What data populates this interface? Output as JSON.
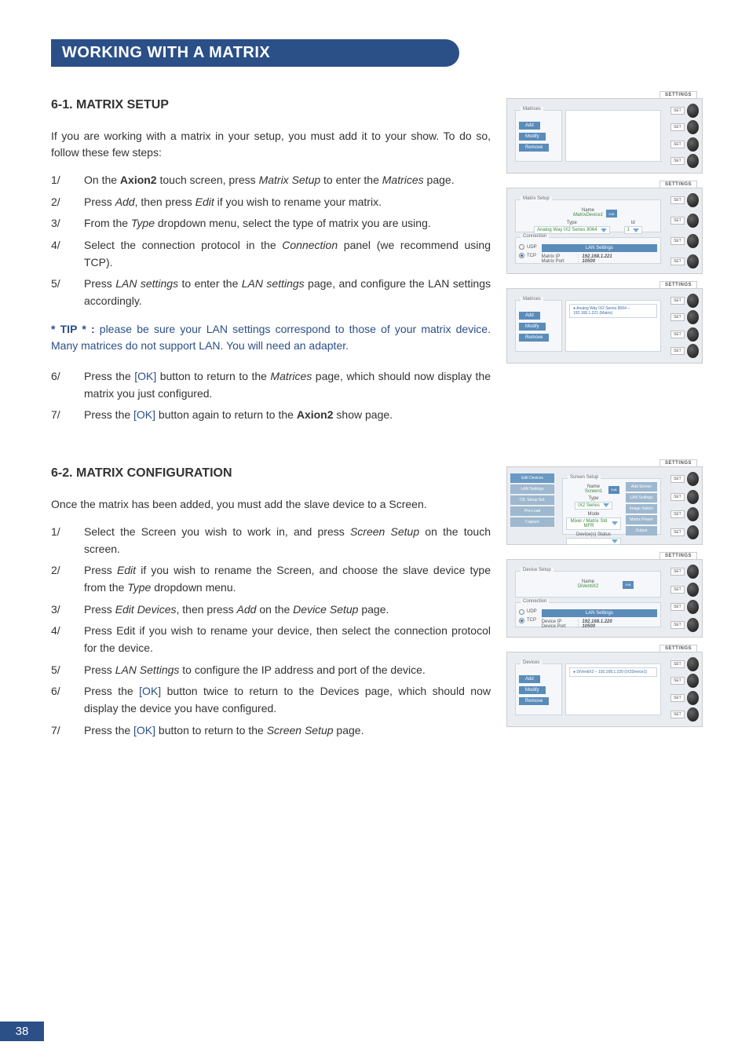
{
  "header": {
    "title": "WORKING WITH A MATRIX"
  },
  "page_number": "38",
  "section1": {
    "heading": "6-1. MATRIX SETUP",
    "intro": "If you are working with a matrix in your setup, you must add it to your show. To do so, follow these few steps:",
    "steps_a": [
      {
        "num": "1/",
        "pre": "On the ",
        "bold": "Axion2",
        "post": " touch screen, press ",
        "ital": "Matrix Setup",
        "tail": " to enter the ",
        "ital2": "Matrices",
        "tail2": " page."
      },
      {
        "num": "2/",
        "pre": "Press ",
        "ital": "Add",
        "mid": ", then press ",
        "ital2": "Edit",
        "tail": " if you wish to rename your matrix."
      },
      {
        "num": "3/",
        "pre": "From the ",
        "ital": "Type",
        "tail": " dropdown menu, select the type of matrix you are using."
      },
      {
        "num": "4/",
        "pre": "Select the connection protocol in the ",
        "ital": "Connection",
        "tail": " panel (we recommend using TCP)."
      },
      {
        "num": "5/",
        "pre": "Press ",
        "ital": "LAN settings",
        "mid": " to enter the ",
        "ital2": "LAN settings",
        "tail": " page, and configure the LAN settings accordingly."
      }
    ],
    "tip_label": "* TIP * : ",
    "tip_text": "please be sure your LAN settings correspond to those of your matrix device. Many matrices do not support LAN. You will need an adapter.",
    "steps_b": [
      {
        "num": "6/",
        "pre": "Press the ",
        "ok": "[OK]",
        "mid": " button to return to the ",
        "ital": "Matrices",
        "tail": " page, which should now display the matrix you just configured."
      },
      {
        "num": "7/",
        "pre": "Press the ",
        "ok": "[OK]",
        "mid": " button again to return to the ",
        "bold": "Axion2",
        "tail": " show page."
      }
    ]
  },
  "section2": {
    "heading": "6-2. MATRIX CONFIGURATION",
    "intro": "Once the matrix has been added, you must add the slave device to a Screen.",
    "steps": [
      {
        "num": "1/",
        "pre": "Select the Screen you wish to work in, and press ",
        "ital": "Screen Setup",
        "tail": " on the touch screen."
      },
      {
        "num": "2/",
        "pre": "Press ",
        "ital": "Edit",
        "mid": " if you wish to rename the Screen, and choose the slave device type from the ",
        "ital2": "Type",
        "tail": " dropdown menu."
      },
      {
        "num": "3/",
        "pre": "Press ",
        "ital": "Edit Devices",
        "mid": ", then press ",
        "ital2": "Add",
        "mid2": " on the ",
        "ital3": "Device Setup",
        "tail": " page."
      },
      {
        "num": "4/",
        "pre": "Press Edit if you wish to rename your device, then select the connection protocol for the device."
      },
      {
        "num": "5/",
        "pre": "Press ",
        "ital": "LAN Settings",
        "tail": " to configure the IP address and port of the device."
      },
      {
        "num": "6/",
        "pre": "Press the ",
        "ok": "[OK]",
        "tail": " button twice to return to the Devices page, which should now display the device you have configured."
      },
      {
        "num": "7/",
        "pre": "Press the ",
        "ok": "[OK]",
        "mid": " button to return to the ",
        "ital": "Screen Setup",
        "tail": " page."
      }
    ]
  },
  "shots": {
    "settings_tab": "SETTINGS",
    "knob_label": "SET",
    "matrices_title": "Matrices",
    "matrix_setup_title": "Matrix Setup",
    "devices_title": "Devices",
    "device_setup_title": "Device Setup",
    "screen_setup_title": "Screen Setup",
    "btn_add": "Add",
    "btn_modify": "Modify",
    "btn_remove": "Remove",
    "name_label": "Name",
    "type_label": "Type",
    "mode_label": "Mode",
    "devices_status": "Device(s) Status",
    "id_label": "Id",
    "connection_label": "Connection",
    "udp": "UDP",
    "tcp": "TCP",
    "lan_settings": "LAN Settings",
    "matrix_ip_label": "Matrix IP",
    "matrix_port_label": "Matrix Port",
    "device_ip_label": "Device IP",
    "device_port_label": "Device Port",
    "ip_value": "192.168.1.221",
    "ip_value2": "192.168.1.220",
    "port_value": "10500",
    "matrix_name_value": "MatrixDevice1",
    "matrix_type_value": "Analog Way IX2 Series 8064",
    "matrix_list_entry": "Analog Way IX2 Series 8064 – 192.168.1.221 (Matrix)",
    "device_name_value": "DiVentiX2",
    "device_list_entry": "DiVentiX2 – 192.168.1.220 (IX2Device1)",
    "screen_name_value": "Screen1",
    "screen_type_value": "IX2 Series",
    "screen_mode_value": "Mixer / Matrix Std MFR",
    "edit_chip": "Edit",
    "sidetabs": {
      "edit_devices": "Edit Devices",
      "lan_settings": "LAN Settings",
      "tb_setup": "T.B. Setup Set.",
      "preload": "Pre-Load",
      "capture": "Capture",
      "add_screen": "Add Screen",
      "image_switch": "Image Switch",
      "matrix_preset": "Matrix Preset",
      "output": "Output"
    }
  }
}
